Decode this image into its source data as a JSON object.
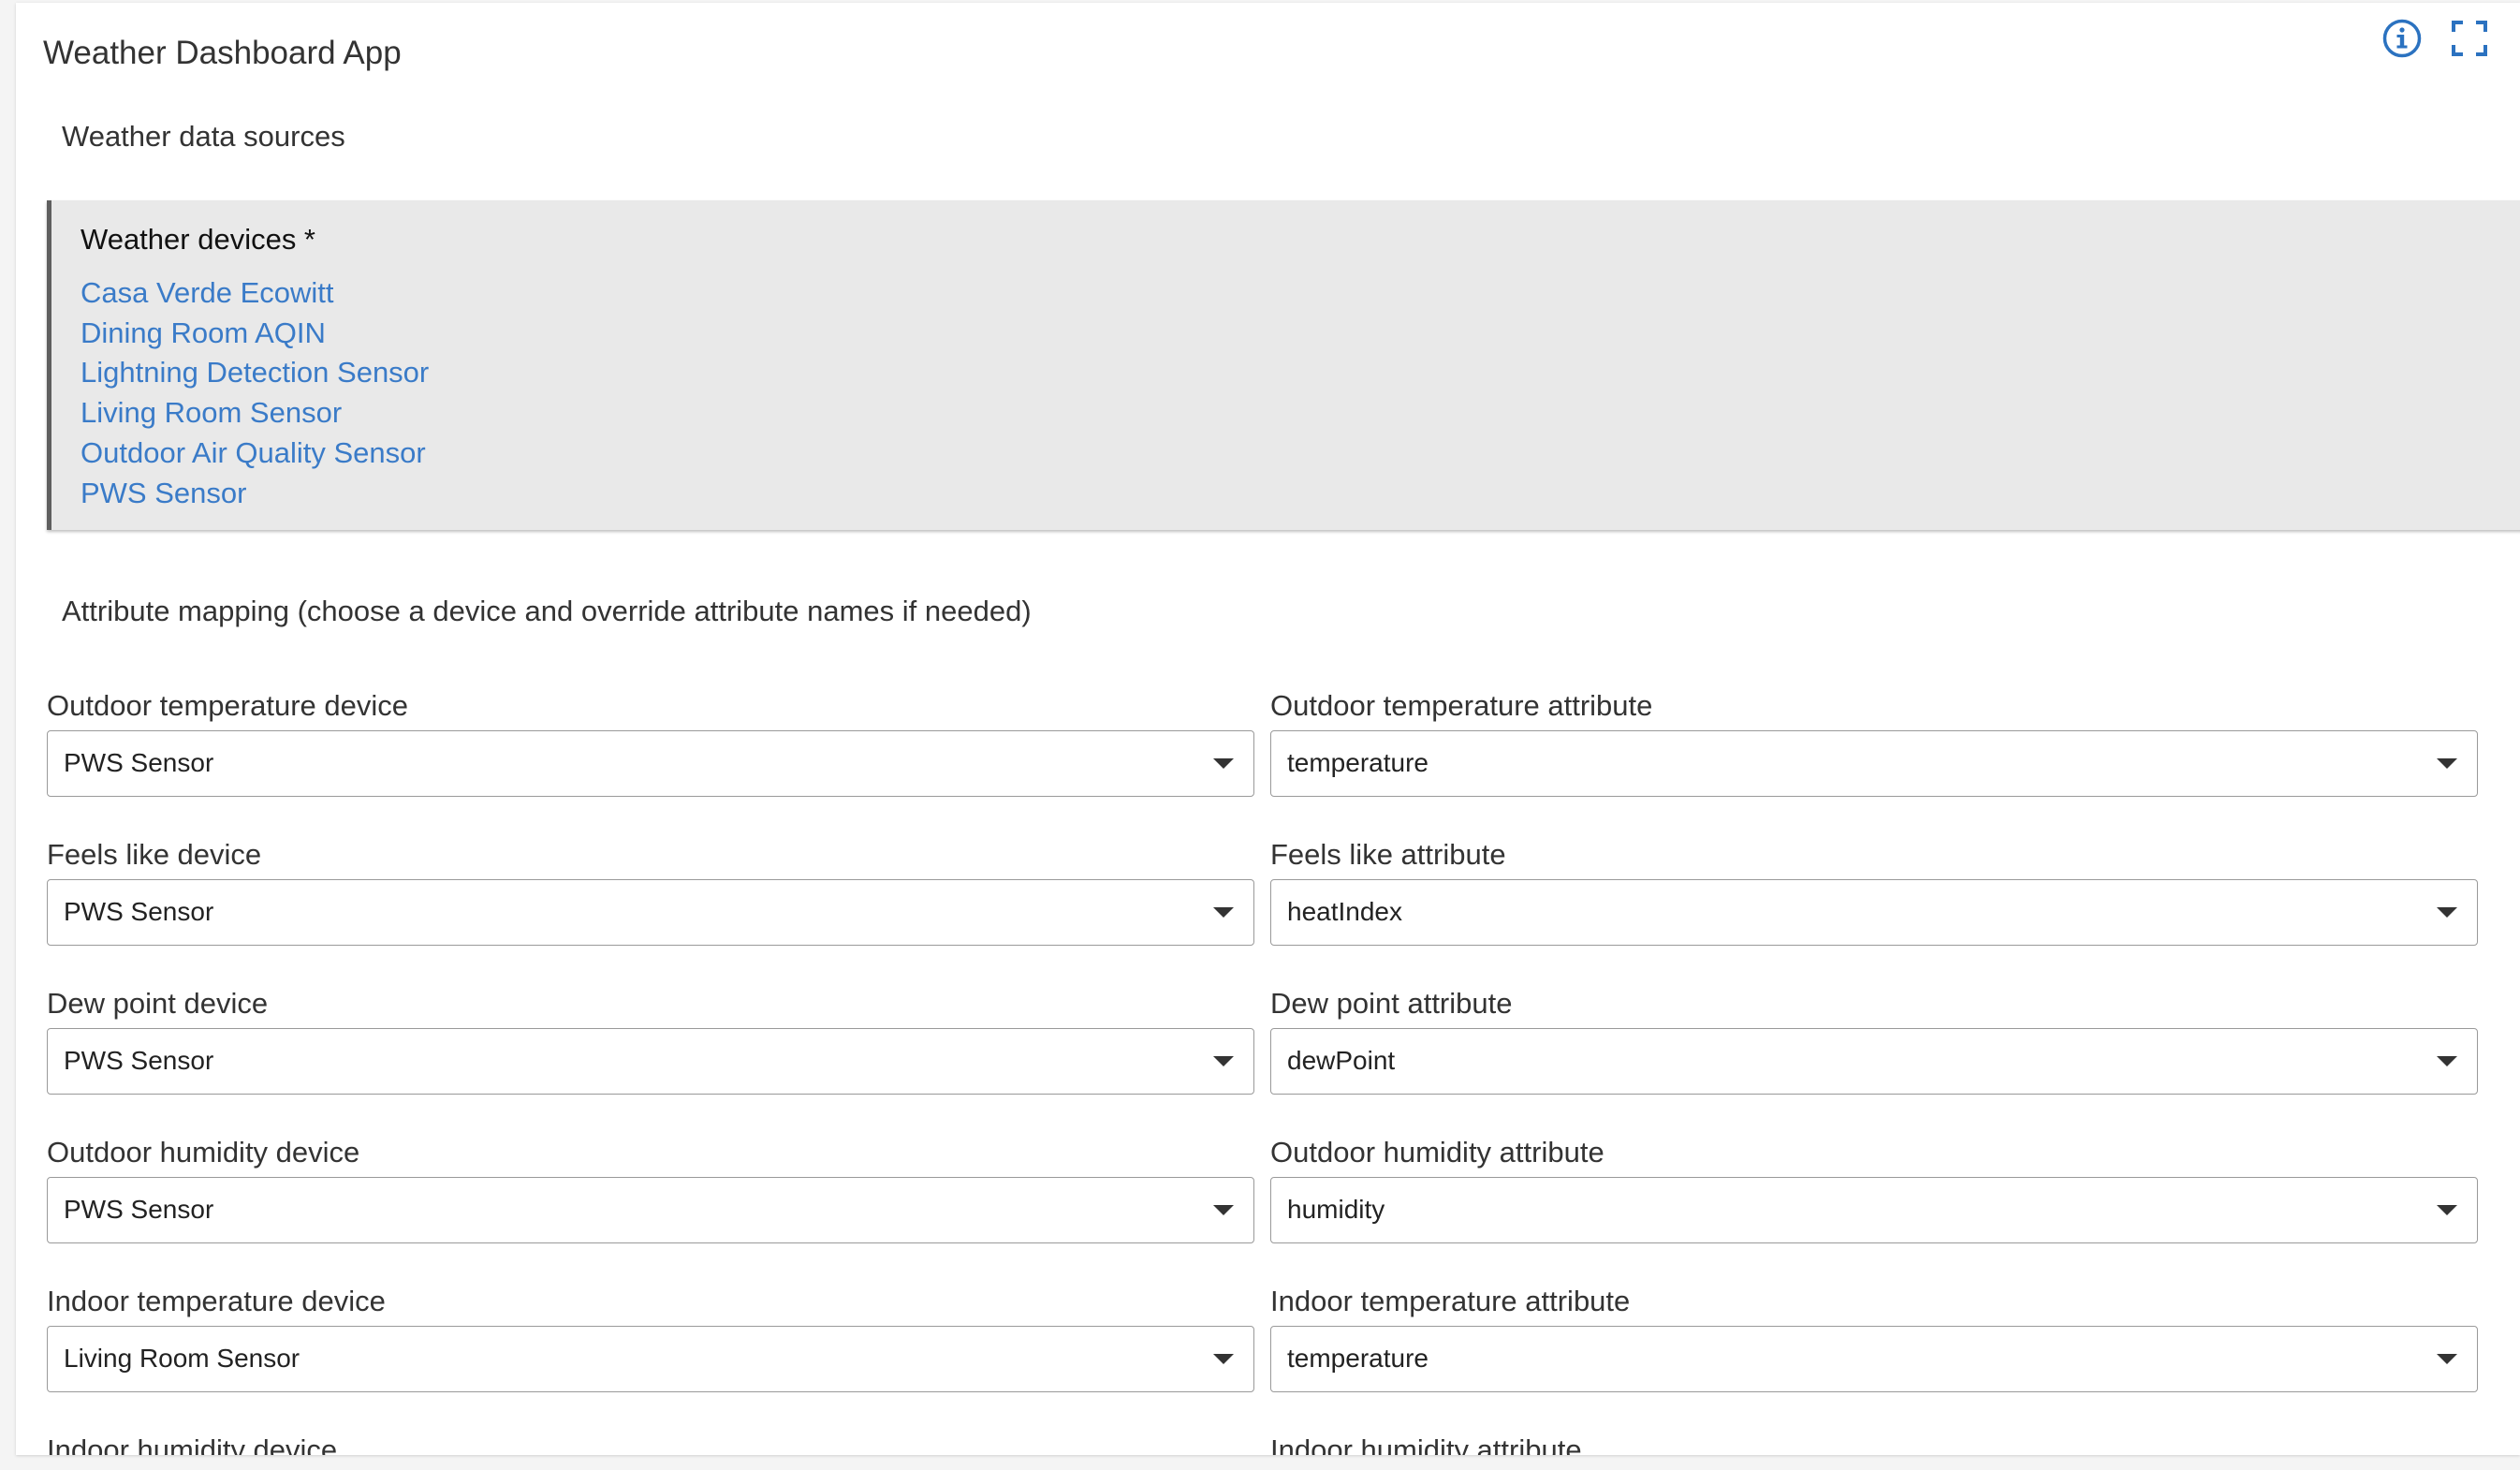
{
  "app": {
    "title": "Weather Dashboard App"
  },
  "icons": {
    "info": "info-icon",
    "fullscreen": "fullscreen-icon",
    "accent_color": "#2b72c0"
  },
  "sources": {
    "heading": "Weather data sources",
    "devices_label": "Weather devices *",
    "devices": [
      "Casa Verde Ecowitt",
      "Dining Room AQIN",
      "Lightning Detection Sensor",
      "Living Room Sensor",
      "Outdoor Air Quality Sensor",
      "PWS Sensor"
    ]
  },
  "mapping": {
    "heading": "Attribute mapping (choose a device and override attribute names if needed)",
    "rows": [
      {
        "device_label": "Outdoor temperature device",
        "device_value": "PWS Sensor",
        "attribute_label": "Outdoor temperature attribute",
        "attribute_value": "temperature"
      },
      {
        "device_label": "Feels like device",
        "device_value": "PWS Sensor",
        "attribute_label": "Feels like attribute",
        "attribute_value": "heatIndex"
      },
      {
        "device_label": "Dew point device",
        "device_value": "PWS Sensor",
        "attribute_label": "Dew point attribute",
        "attribute_value": "dewPoint"
      },
      {
        "device_label": "Outdoor humidity device",
        "device_value": "PWS Sensor",
        "attribute_label": "Outdoor humidity attribute",
        "attribute_value": "humidity"
      },
      {
        "device_label": "Indoor temperature device",
        "device_value": "Living Room Sensor",
        "attribute_label": "Indoor temperature attribute",
        "attribute_value": "temperature"
      },
      {
        "device_label": "Indoor humidity device",
        "device_value": "",
        "attribute_label": "Indoor humidity attribute",
        "attribute_value": ""
      }
    ]
  }
}
